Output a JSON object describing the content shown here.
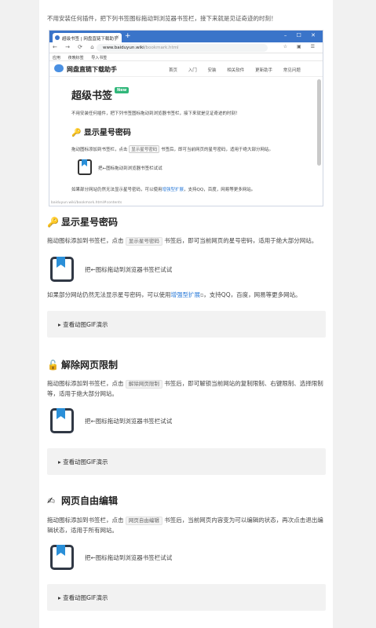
{
  "intro": "不用安装任何插件，把下列书签图标拖动到浏览器书签栏，接下来就是见证奇迹的时刻！",
  "screenshot": {
    "tab_title": "超级书签 | 网盘直链下载助手",
    "address": "www.baiduyun.wiki",
    "address_path": "/bookmark.html",
    "bookmarks": [
      "应用",
      "夜晚标签",
      "导入书签"
    ],
    "site_name": "网盘直链下载助手",
    "nav": [
      "首页",
      "入门",
      "安装",
      "相关软件",
      "更新助手",
      "常见问题"
    ],
    "h1": "超级书签",
    "new_badge": "New",
    "p1": "不用安装任何插件，把下列书签图标拖动到浏览器书签栏，接下来就是见证奇迹的时刻！",
    "h2": "🔑 显示星号密码",
    "p2_a": "拖动图标添加到书签栏，点击",
    "p2_kw": "显示星号密码",
    "p2_b": "书签后，即可当前网页的星号密码，适用于绝大部分网站。",
    "bm_label": "把←图标拖动到浏览器书签栏试试",
    "p3_a": "如果部分网站仍然无法显示星号密码，可以使用",
    "p3_link": "增强型扩展",
    "p3_b": "，支持QQ，百度，网易等更多网站。",
    "status": "baiduyun.wiki/bookmark.html#contents"
  },
  "sections": [
    {
      "icon": "🔑",
      "title": "显示星号密码",
      "text_a": "拖动图标添加到书签栏，点击",
      "keyword": "显示星号密码",
      "text_b": "书签后，即可当前网页的星号密码，适用于绝大部分网站。",
      "bookmark_label": "把←图标拖动到浏览器书签栏试试",
      "extra_a": "如果部分网站仍然无法显示星号密码，可以使用",
      "extra_link": "增强型扩展",
      "extra_b": "，支持QQ，百度，网易等更多网站。",
      "gif_label": "▸ 查看动图GIF演示"
    },
    {
      "icon": "🔓",
      "title": "解除网页限制",
      "text_a": "拖动图标添加到书签栏，点击",
      "keyword": "解除网页限制",
      "text_b": "书签后，即可解锁当前网站的复制限制、右键限制、选择限制等，适用于绝大部分网站。",
      "bookmark_label": "把←图标拖动到浏览器书签栏试试",
      "gif_label": "▸ 查看动图GIF演示"
    },
    {
      "icon": "✍",
      "title": "网页自由编辑",
      "text_a": "拖动图标添加到书签栏，点击",
      "keyword": "网页自由编辑",
      "text_b": "书签后，当前网页内容变为可以编辑的状态，再次点击退出编辑状态，适用于所有网站。",
      "bookmark_label": "把←图标拖动到浏览器书签栏试试",
      "gif_label": "▸ 查看动图GIF演示"
    }
  ]
}
